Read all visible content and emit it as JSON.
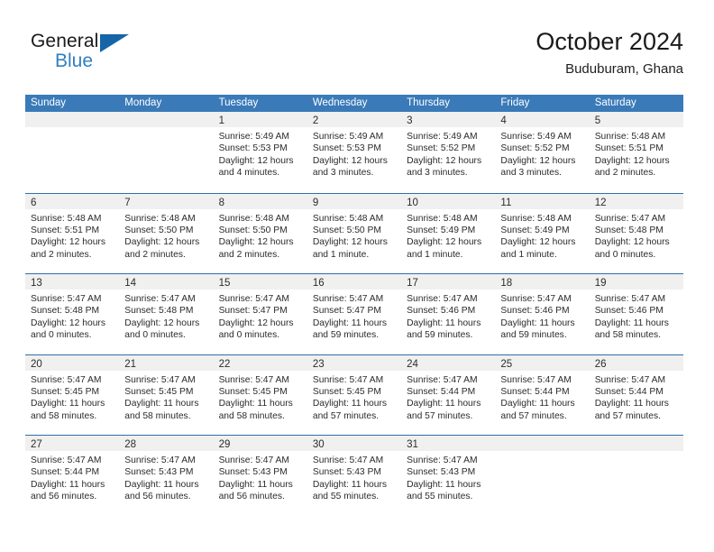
{
  "brand": {
    "word_top": "General",
    "word_bottom": "Blue",
    "triangle_icon": "brand-triangle-icon",
    "accent_color": "#1565a8",
    "blue_text_color": "#2f7fc1"
  },
  "header": {
    "title": "October 2024",
    "subtitle": "Buduburam, Ghana"
  },
  "theme": {
    "header_blue": "#3a7ab8",
    "row_divider_blue": "#2f6fad",
    "day_band_gray": "#f0f0f0",
    "text_color": "#2b2b2b"
  },
  "weekday_headers": [
    "Sunday",
    "Monday",
    "Tuesday",
    "Wednesday",
    "Thursday",
    "Friday",
    "Saturday"
  ],
  "weeks": [
    [
      {
        "day": "",
        "lines": []
      },
      {
        "day": "",
        "lines": []
      },
      {
        "day": "1",
        "lines": [
          "Sunrise: 5:49 AM",
          "Sunset: 5:53 PM",
          "Daylight: 12 hours",
          "and 4 minutes."
        ]
      },
      {
        "day": "2",
        "lines": [
          "Sunrise: 5:49 AM",
          "Sunset: 5:53 PM",
          "Daylight: 12 hours",
          "and 3 minutes."
        ]
      },
      {
        "day": "3",
        "lines": [
          "Sunrise: 5:49 AM",
          "Sunset: 5:52 PM",
          "Daylight: 12 hours",
          "and 3 minutes."
        ]
      },
      {
        "day": "4",
        "lines": [
          "Sunrise: 5:49 AM",
          "Sunset: 5:52 PM",
          "Daylight: 12 hours",
          "and 3 minutes."
        ]
      },
      {
        "day": "5",
        "lines": [
          "Sunrise: 5:48 AM",
          "Sunset: 5:51 PM",
          "Daylight: 12 hours",
          "and 2 minutes."
        ]
      }
    ],
    [
      {
        "day": "6",
        "lines": [
          "Sunrise: 5:48 AM",
          "Sunset: 5:51 PM",
          "Daylight: 12 hours",
          "and 2 minutes."
        ]
      },
      {
        "day": "7",
        "lines": [
          "Sunrise: 5:48 AM",
          "Sunset: 5:50 PM",
          "Daylight: 12 hours",
          "and 2 minutes."
        ]
      },
      {
        "day": "8",
        "lines": [
          "Sunrise: 5:48 AM",
          "Sunset: 5:50 PM",
          "Daylight: 12 hours",
          "and 2 minutes."
        ]
      },
      {
        "day": "9",
        "lines": [
          "Sunrise: 5:48 AM",
          "Sunset: 5:50 PM",
          "Daylight: 12 hours",
          "and 1 minute."
        ]
      },
      {
        "day": "10",
        "lines": [
          "Sunrise: 5:48 AM",
          "Sunset: 5:49 PM",
          "Daylight: 12 hours",
          "and 1 minute."
        ]
      },
      {
        "day": "11",
        "lines": [
          "Sunrise: 5:48 AM",
          "Sunset: 5:49 PM",
          "Daylight: 12 hours",
          "and 1 minute."
        ]
      },
      {
        "day": "12",
        "lines": [
          "Sunrise: 5:47 AM",
          "Sunset: 5:48 PM",
          "Daylight: 12 hours",
          "and 0 minutes."
        ]
      }
    ],
    [
      {
        "day": "13",
        "lines": [
          "Sunrise: 5:47 AM",
          "Sunset: 5:48 PM",
          "Daylight: 12 hours",
          "and 0 minutes."
        ]
      },
      {
        "day": "14",
        "lines": [
          "Sunrise: 5:47 AM",
          "Sunset: 5:48 PM",
          "Daylight: 12 hours",
          "and 0 minutes."
        ]
      },
      {
        "day": "15",
        "lines": [
          "Sunrise: 5:47 AM",
          "Sunset: 5:47 PM",
          "Daylight: 12 hours",
          "and 0 minutes."
        ]
      },
      {
        "day": "16",
        "lines": [
          "Sunrise: 5:47 AM",
          "Sunset: 5:47 PM",
          "Daylight: 11 hours",
          "and 59 minutes."
        ]
      },
      {
        "day": "17",
        "lines": [
          "Sunrise: 5:47 AM",
          "Sunset: 5:46 PM",
          "Daylight: 11 hours",
          "and 59 minutes."
        ]
      },
      {
        "day": "18",
        "lines": [
          "Sunrise: 5:47 AM",
          "Sunset: 5:46 PM",
          "Daylight: 11 hours",
          "and 59 minutes."
        ]
      },
      {
        "day": "19",
        "lines": [
          "Sunrise: 5:47 AM",
          "Sunset: 5:46 PM",
          "Daylight: 11 hours",
          "and 58 minutes."
        ]
      }
    ],
    [
      {
        "day": "20",
        "lines": [
          "Sunrise: 5:47 AM",
          "Sunset: 5:45 PM",
          "Daylight: 11 hours",
          "and 58 minutes."
        ]
      },
      {
        "day": "21",
        "lines": [
          "Sunrise: 5:47 AM",
          "Sunset: 5:45 PM",
          "Daylight: 11 hours",
          "and 58 minutes."
        ]
      },
      {
        "day": "22",
        "lines": [
          "Sunrise: 5:47 AM",
          "Sunset: 5:45 PM",
          "Daylight: 11 hours",
          "and 58 minutes."
        ]
      },
      {
        "day": "23",
        "lines": [
          "Sunrise: 5:47 AM",
          "Sunset: 5:45 PM",
          "Daylight: 11 hours",
          "and 57 minutes."
        ]
      },
      {
        "day": "24",
        "lines": [
          "Sunrise: 5:47 AM",
          "Sunset: 5:44 PM",
          "Daylight: 11 hours",
          "and 57 minutes."
        ]
      },
      {
        "day": "25",
        "lines": [
          "Sunrise: 5:47 AM",
          "Sunset: 5:44 PM",
          "Daylight: 11 hours",
          "and 57 minutes."
        ]
      },
      {
        "day": "26",
        "lines": [
          "Sunrise: 5:47 AM",
          "Sunset: 5:44 PM",
          "Daylight: 11 hours",
          "and 57 minutes."
        ]
      }
    ],
    [
      {
        "day": "27",
        "lines": [
          "Sunrise: 5:47 AM",
          "Sunset: 5:44 PM",
          "Daylight: 11 hours",
          "and 56 minutes."
        ]
      },
      {
        "day": "28",
        "lines": [
          "Sunrise: 5:47 AM",
          "Sunset: 5:43 PM",
          "Daylight: 11 hours",
          "and 56 minutes."
        ]
      },
      {
        "day": "29",
        "lines": [
          "Sunrise: 5:47 AM",
          "Sunset: 5:43 PM",
          "Daylight: 11 hours",
          "and 56 minutes."
        ]
      },
      {
        "day": "30",
        "lines": [
          "Sunrise: 5:47 AM",
          "Sunset: 5:43 PM",
          "Daylight: 11 hours",
          "and 55 minutes."
        ]
      },
      {
        "day": "31",
        "lines": [
          "Sunrise: 5:47 AM",
          "Sunset: 5:43 PM",
          "Daylight: 11 hours",
          "and 55 minutes."
        ]
      },
      {
        "day": "",
        "lines": []
      },
      {
        "day": "",
        "lines": []
      }
    ]
  ]
}
